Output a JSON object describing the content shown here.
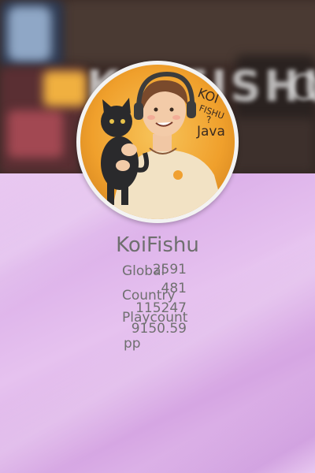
{
  "profile": {
    "username": "KoiFishu",
    "avatar_icon": "user-avatar-illustration",
    "avatar_text": "KOI FISHU ? Java",
    "banner_text": "KOIFISHU"
  },
  "stats": {
    "global_label": "Global",
    "global_value": "2591",
    "country_label": "Country",
    "country_value": "481",
    "playcount_label": "Playcount",
    "playcount_value": "115247",
    "pp_value": "9150.59",
    "pp_unit": "pp"
  },
  "colors": {
    "accent_purple": "#dcb0e9",
    "text_gray": "#707070",
    "avatar_bg": "#f0a830"
  }
}
